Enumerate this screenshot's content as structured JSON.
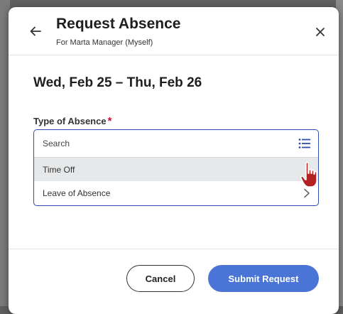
{
  "dialog": {
    "title": "Request Absence",
    "subtitle": "For Marta Manager (Myself)",
    "date_range": "Wed, Feb 25 – Thu, Feb 26"
  },
  "field": {
    "label": "Type of Absence",
    "required_mark": "*",
    "search_placeholder": "Search",
    "options": [
      {
        "label": "Time Off",
        "hovered": true
      },
      {
        "label": "Leave of Absence",
        "has_submenu": true
      }
    ]
  },
  "footer": {
    "cancel_label": "Cancel",
    "submit_label": "Submit Request"
  },
  "icons": {
    "back": "arrow-left-icon",
    "close": "close-icon",
    "list": "list-icon",
    "chevron": "chevron-right-icon",
    "cursor": "hand-pointer-icon"
  },
  "colors": {
    "accent": "#4a75d6",
    "focus_border": "#2f4fb0",
    "required": "#c8102e",
    "hover_row": "#e6e8ea",
    "cursor": "#b22222"
  }
}
